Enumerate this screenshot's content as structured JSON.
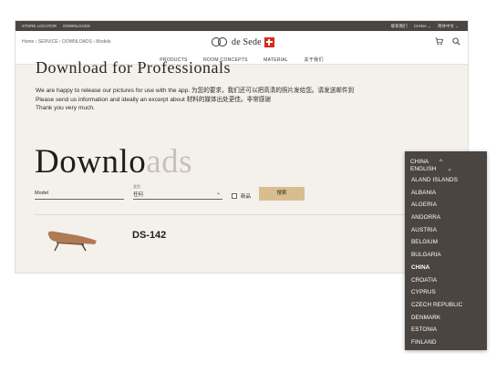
{
  "topbar": {
    "left_links": [
      "STORE LOCATOR",
      "DOWNLOADS"
    ],
    "right_links": [
      "联系我们",
      "CHINA ⌄",
      "简体中文 ⌄"
    ]
  },
  "header": {
    "breadcrumb": "Home › SERVICE › DOWNLOADS › Models",
    "logo_text": "de Sede",
    "cart_icon": "cart-icon",
    "search_icon": "search-icon"
  },
  "nav": {
    "items": [
      "PRODUCTS",
      "ROOM CONCEPTS",
      "MATERIAL",
      "关于我们"
    ]
  },
  "main": {
    "title": "Download for Professionals",
    "paragraphs": [
      "We are happy to release our pictures for use with the app. 为您的要求，我们还可以把高清的照片发给您。请发送邮件到",
      "Please send us information and ideally an excerpt about 材料的媒体出处更佳。非常感谢",
      "Thank you very much."
    ],
    "downloads_title_dark": "Downlo",
    "downloads_title_fade": "ads",
    "filters": {
      "model_placeholder": "Model",
      "type_label": "类型",
      "type_value": "任何",
      "checkbox_label": "新品",
      "search_button": "搜索"
    },
    "product": {
      "name": "DS-142"
    }
  },
  "country_dropdown": {
    "country": "CHINA",
    "language": "ENGLISH",
    "items": [
      "ALAND ISLANDS",
      "ALBANIA",
      "ALGERIA",
      "ANDORRA",
      "AUSTRIA",
      "BELGIUM",
      "BULGARIA",
      "CHINA",
      "CROATIA",
      "CYPRUS",
      "CZECH REPUBLIC",
      "DENMARK",
      "ESTONIA",
      "FINLAND"
    ],
    "selected": "CHINA"
  },
  "colors": {
    "topbar": "#4a4541",
    "accent_button": "#d8be8f",
    "page_bg": "#f4f1ed"
  }
}
